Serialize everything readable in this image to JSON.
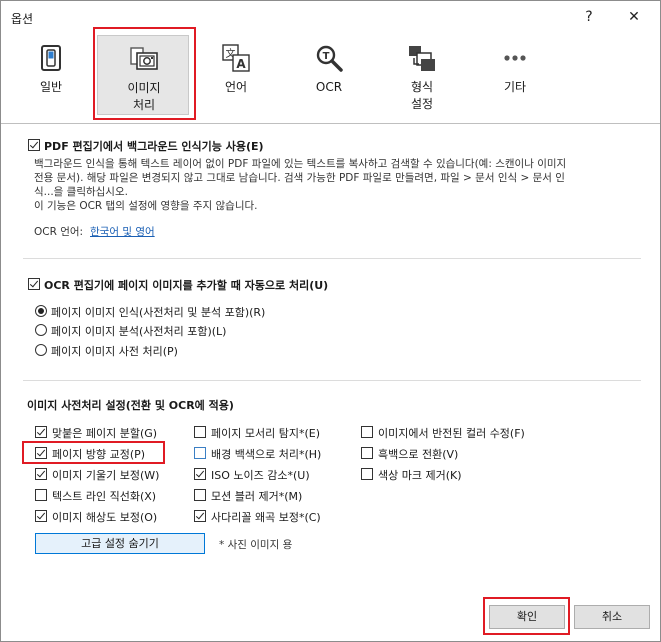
{
  "title": "옵션",
  "title_buttons": {
    "help": "?",
    "close": "✕"
  },
  "tabs": [
    {
      "label": "일반",
      "icon": "toggle-icon"
    },
    {
      "label": "이미지\n처리",
      "icon": "image-processing-icon",
      "selected": true
    },
    {
      "label": "언어",
      "icon": "language-icon"
    },
    {
      "label": "OCR",
      "icon": "ocr-magnifier-icon"
    },
    {
      "label": "형식\n설정",
      "icon": "format-settings-icon"
    },
    {
      "label": "기타",
      "icon": "more-icon"
    }
  ],
  "pdf_section": {
    "checkbox_label": "PDF 편집기에서 백그라운드 인식기능 사용(E)",
    "checked": true,
    "description": "백그라운드 인식을 통해 텍스트 레이어 없이 PDF 파일에 있는 텍스트를 복사하고 검색할 수 있습니다(예: 스캔이나 이미지\n전용 문서). 해당 파일은 변경되지 않고 그대로 남습니다. 검색 가능한 PDF 파일로 만들려면, 파일 > 문서 인식 > 문서 인\n식...을 클릭하십시오.\n이 기능은 OCR 탭의 설정에 영향을 주지 않습니다.",
    "ocr_language_label": "OCR 언어:",
    "ocr_language_link": "한국어 및 영어"
  },
  "ocr_section": {
    "checkbox_label": "OCR 편집기에 페이지 이미지를 추가할 때 자동으로 처리(U)",
    "checked": true,
    "options": [
      {
        "label": "페이지 이미지 인식(사전처리 및 분석 포함)(R)",
        "selected": true
      },
      {
        "label": "페이지 이미지 분석(사전처리 포함)(L)",
        "selected": false
      },
      {
        "label": "페이지 이미지 사전 처리(P)",
        "selected": false
      }
    ]
  },
  "preprocess_section": {
    "heading": "이미지 사전처리 설정(전환 및 OCR에 적용)",
    "col1": [
      {
        "label": "맞붙은 페이지 분할(G)",
        "checked": true
      },
      {
        "label": "페이지 방향 교정(P)",
        "checked": true
      },
      {
        "label": "이미지 기울기 보정(W)",
        "checked": true
      },
      {
        "label": "텍스트 라인 직선화(X)",
        "checked": false
      },
      {
        "label": "이미지 해상도 보정(O)",
        "checked": true
      }
    ],
    "col2": [
      {
        "label": "페이지 모서리 탐지*(E)",
        "checked": false
      },
      {
        "label": "배경 백색으로 처리*(H)",
        "checked": false
      },
      {
        "label": "ISO 노이즈 감소*(U)",
        "checked": true
      },
      {
        "label": "모션 블러 제거*(M)",
        "checked": false
      },
      {
        "label": "사다리꼴 왜곡 보정*(C)",
        "checked": true
      }
    ],
    "col3": [
      {
        "label": "이미지에서 반전된 컬러 수정(F)",
        "checked": false
      },
      {
        "label": "흑백으로 전환(V)",
        "checked": false
      },
      {
        "label": "색상 마크 제거(K)",
        "checked": false
      }
    ],
    "advanced_button": "고급 설정 숨기기",
    "footnote": "* 사진 이미지 용"
  },
  "footer": {
    "ok": "확인",
    "cancel": "취소"
  },
  "colors": {
    "highlight": "#e01b24",
    "link": "#1a5fb4",
    "selected_tab_bg": "#e6e6e6"
  }
}
